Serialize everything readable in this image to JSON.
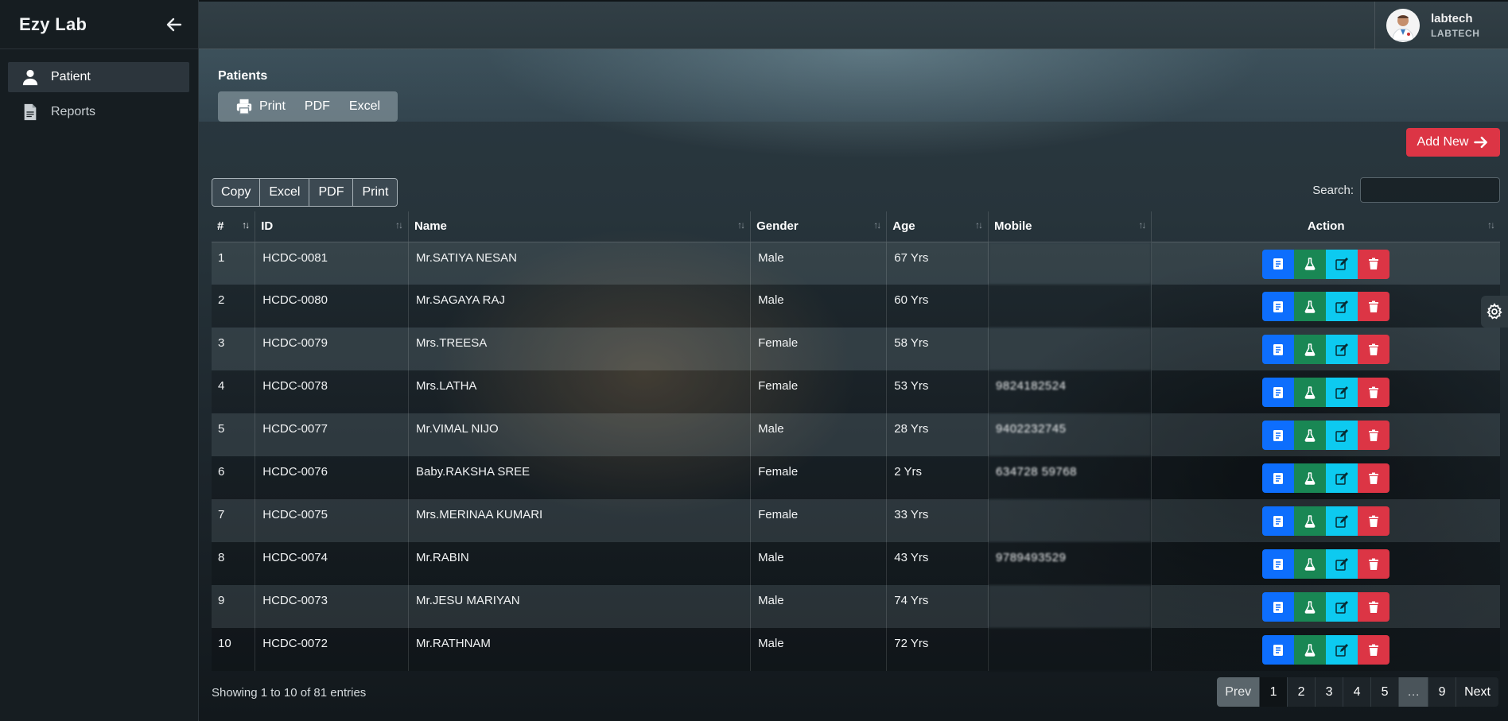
{
  "sidebar": {
    "brand": "Ezy Lab",
    "items": [
      {
        "label": "Patient",
        "icon": "user-icon",
        "active": true
      },
      {
        "label": "Reports",
        "icon": "file-icon",
        "active": false
      }
    ]
  },
  "user": {
    "name": "labtech",
    "role": "LABTECH"
  },
  "page": {
    "title": "Patients",
    "export_buttons": [
      "Print",
      "PDF",
      "Excel"
    ],
    "add_new_label": "Add New"
  },
  "table_tools": {
    "buttons": [
      "Copy",
      "Excel",
      "PDF",
      "Print"
    ],
    "search_label": "Search:",
    "search_value": ""
  },
  "table": {
    "headers": [
      "#",
      "ID",
      "Name",
      "Gender",
      "Age",
      "Mobile",
      "Action"
    ],
    "rows": [
      {
        "n": "1",
        "id": "HCDC-0081",
        "name": "Mr.SATIYA NESAN",
        "gender": "Male",
        "age": "67 Yrs",
        "mobile": ""
      },
      {
        "n": "2",
        "id": "HCDC-0080",
        "name": "Mr.SAGAYA RAJ",
        "gender": "Male",
        "age": "60 Yrs",
        "mobile": ""
      },
      {
        "n": "3",
        "id": "HCDC-0079",
        "name": "Mrs.TREESA",
        "gender": "Female",
        "age": "58 Yrs",
        "mobile": ""
      },
      {
        "n": "4",
        "id": "HCDC-0078",
        "name": "Mrs.LATHA",
        "gender": "Female",
        "age": "53 Yrs",
        "mobile": "9824182524"
      },
      {
        "n": "5",
        "id": "HCDC-0077",
        "name": "Mr.VIMAL NIJO",
        "gender": "Male",
        "age": "28 Yrs",
        "mobile": "9402232745"
      },
      {
        "n": "6",
        "id": "HCDC-0076",
        "name": "Baby.RAKSHA SREE",
        "gender": "Female",
        "age": "2 Yrs",
        "mobile": "634728 59768"
      },
      {
        "n": "7",
        "id": "HCDC-0075",
        "name": "Mrs.MERINAA KUMARI",
        "gender": "Female",
        "age": "33 Yrs",
        "mobile": ""
      },
      {
        "n": "8",
        "id": "HCDC-0074",
        "name": "Mr.RABIN",
        "gender": "Male",
        "age": "43 Yrs",
        "mobile": "9789493529"
      },
      {
        "n": "9",
        "id": "HCDC-0073",
        "name": "Mr.JESU MARIYAN",
        "gender": "Male",
        "age": "74 Yrs",
        "mobile": ""
      },
      {
        "n": "10",
        "id": "HCDC-0072",
        "name": "Mr.RATHNAM",
        "gender": "Male",
        "age": "72 Yrs",
        "mobile": ""
      }
    ],
    "action_icons": [
      "report-icon",
      "flask-icon",
      "edit-icon",
      "trash-icon"
    ]
  },
  "footer": {
    "info": "Showing 1 to 10 of 81 entries",
    "pagination": [
      "Prev",
      "1",
      "2",
      "3",
      "4",
      "5",
      "…",
      "9",
      "Next"
    ],
    "current_page": "1"
  },
  "colors": {
    "primary": "#0d6efd",
    "success": "#198754",
    "info": "#0dcaf0",
    "danger": "#dc3545",
    "sidebar_bg": "#161d21"
  }
}
